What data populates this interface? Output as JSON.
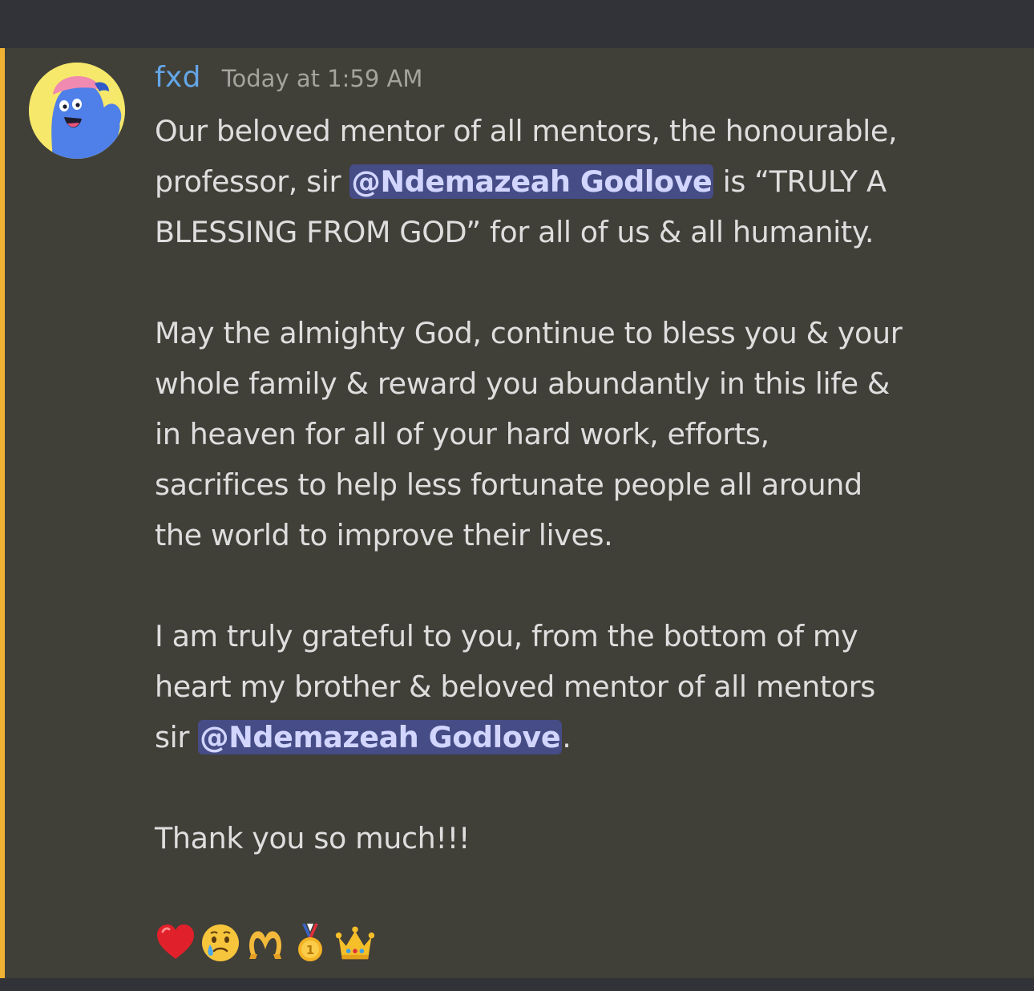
{
  "message": {
    "author": "fxd",
    "timestamp": "Today at 1:59 AM",
    "paragraphs": [
      {
        "lines": [
          {
            "text": "Our beloved mentor of all mentors, the  honourable,"
          },
          {
            "before": "professor, sir ",
            "mention": "@Ndemazeah Godlove",
            "after": " is “TRULY A"
          },
          {
            "text": "BLESSING FROM GOD” for all of us & all humanity."
          }
        ]
      },
      {
        "lines": [
          {
            "text": "May the almighty God, continue to bless you & your"
          },
          {
            "text": "whole family & reward you abundantly in this life &"
          },
          {
            "text": "in heaven for all of your hard work, efforts,"
          },
          {
            "text": "sacrifices to help less fortunate people all around"
          },
          {
            "text": "the world to improve their lives."
          }
        ]
      },
      {
        "lines": [
          {
            "text": "I am truly grateful to you, from the bottom of my"
          },
          {
            "text": "heart my brother & beloved mentor of all mentors"
          },
          {
            "before": "sir ",
            "mention": "@Ndemazeah Godlove",
            "after": "."
          }
        ]
      },
      {
        "lines": [
          {
            "text": "Thank you so much!!!"
          }
        ]
      }
    ],
    "emojis": [
      "red-heart",
      "face-holding-back-tears",
      "heart-hands",
      "first-place-medal",
      "crown"
    ]
  },
  "colors": {
    "background": "#313338",
    "message_highlight": "#403f38",
    "highlight_bar": "#f0b232",
    "username": "#64a6e6",
    "timestamp": "#a5a49c",
    "text": "#dedede",
    "mention_bg": "#464c86",
    "mention_text": "#d2d6ff"
  }
}
